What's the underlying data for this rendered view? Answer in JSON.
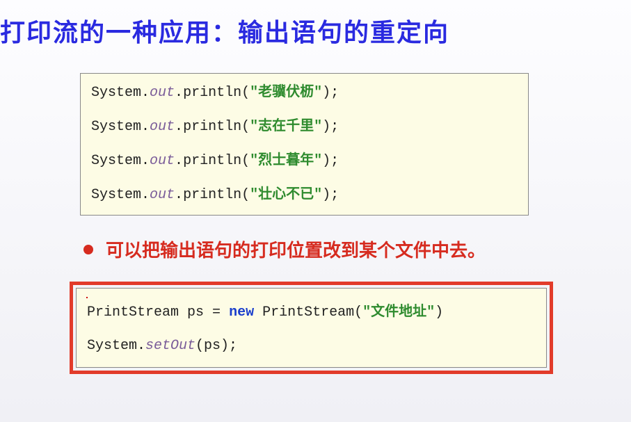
{
  "title": "打印流的一种应用：输出语句的重定向",
  "code1": {
    "lines": [
      {
        "sys": "System",
        "dot1": ".",
        "out": "out",
        "dot2": ".",
        "method": "println",
        "open": "(",
        "str": "\"老骥伏枥\"",
        "close": ");"
      },
      {
        "sys": "System",
        "dot1": ".",
        "out": "out",
        "dot2": ".",
        "method": "println",
        "open": "(",
        "str": "\"志在千里\"",
        "close": ");"
      },
      {
        "sys": "System",
        "dot1": ".",
        "out": "out",
        "dot2": ".",
        "method": "println",
        "open": "(",
        "str": "\"烈士暮年\"",
        "close": ");"
      },
      {
        "sys": "System",
        "dot1": ".",
        "out": "out",
        "dot2": ".",
        "method": "println",
        "open": "(",
        "str": "\"壮心不已\"",
        "close": ");"
      }
    ]
  },
  "bullet": "可以把输出语句的打印位置改到某个文件中去。",
  "code2": {
    "line1": {
      "type": "PrintStream",
      "var": " ps ",
      "eq": "=",
      "sp": " ",
      "new": "new",
      "ctor": " PrintStream(",
      "str": "\"文件地址\"",
      "close": ")"
    },
    "line2": {
      "sys": "System",
      "dot": ".",
      "method": "setOut",
      "open": "(ps);",
      "close": ""
    }
  }
}
